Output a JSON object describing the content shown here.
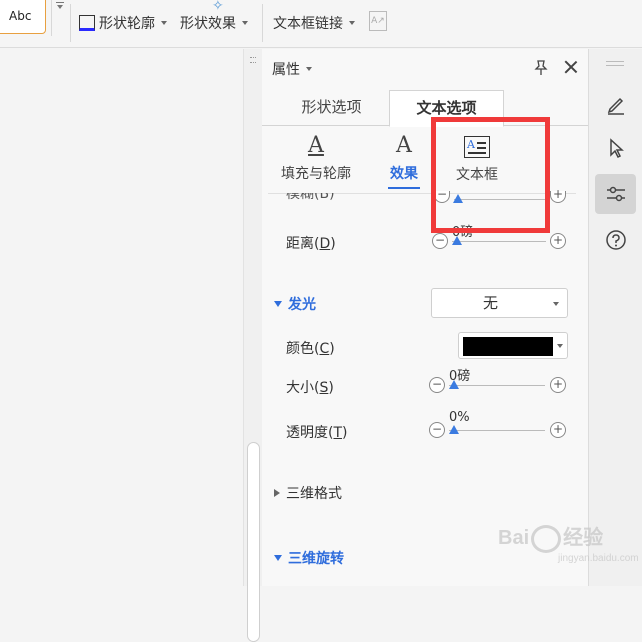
{
  "toolbar": {
    "style_sample": "Abc",
    "shape_outline": "形状轮廓",
    "shape_effect": "形状效果",
    "textbox_link": "文本框链接"
  },
  "pane": {
    "title": "属性",
    "tabs": [
      {
        "label": "形状选项",
        "active": false
      },
      {
        "label": "文本选项",
        "active": true
      }
    ],
    "subtabs": [
      {
        "label": "填充与轮廓",
        "icon": "text-fill-icon",
        "active": false
      },
      {
        "label": "效果",
        "icon": "text-effect-icon",
        "active": true
      },
      {
        "label": "文本框",
        "icon": "textbox-icon",
        "active": false
      }
    ],
    "blur_label_partial": "模糊(B)",
    "distance": {
      "label": "距离",
      "key": "D",
      "value": "0磅",
      "fraction": 0.0
    },
    "glow": {
      "title": "发光",
      "preset": "无",
      "color_label": "颜色",
      "color_key": "C",
      "color_value": "#000000",
      "size_label": "大小",
      "size_key": "S",
      "size_value": "0磅",
      "transparency_label": "透明度",
      "transparency_key": "T",
      "transparency_value": "0%"
    },
    "format3d": {
      "title": "三维格式"
    },
    "rotation3d": {
      "title": "三维旋转"
    }
  },
  "rail": {
    "buttons": [
      "edit-icon",
      "select-cursor-icon",
      "properties-icon",
      "help-icon"
    ],
    "active": "properties-icon"
  },
  "watermark": {
    "text": "Bai",
    "text2": "经验",
    "sub": "jingyan.baidu.com"
  }
}
